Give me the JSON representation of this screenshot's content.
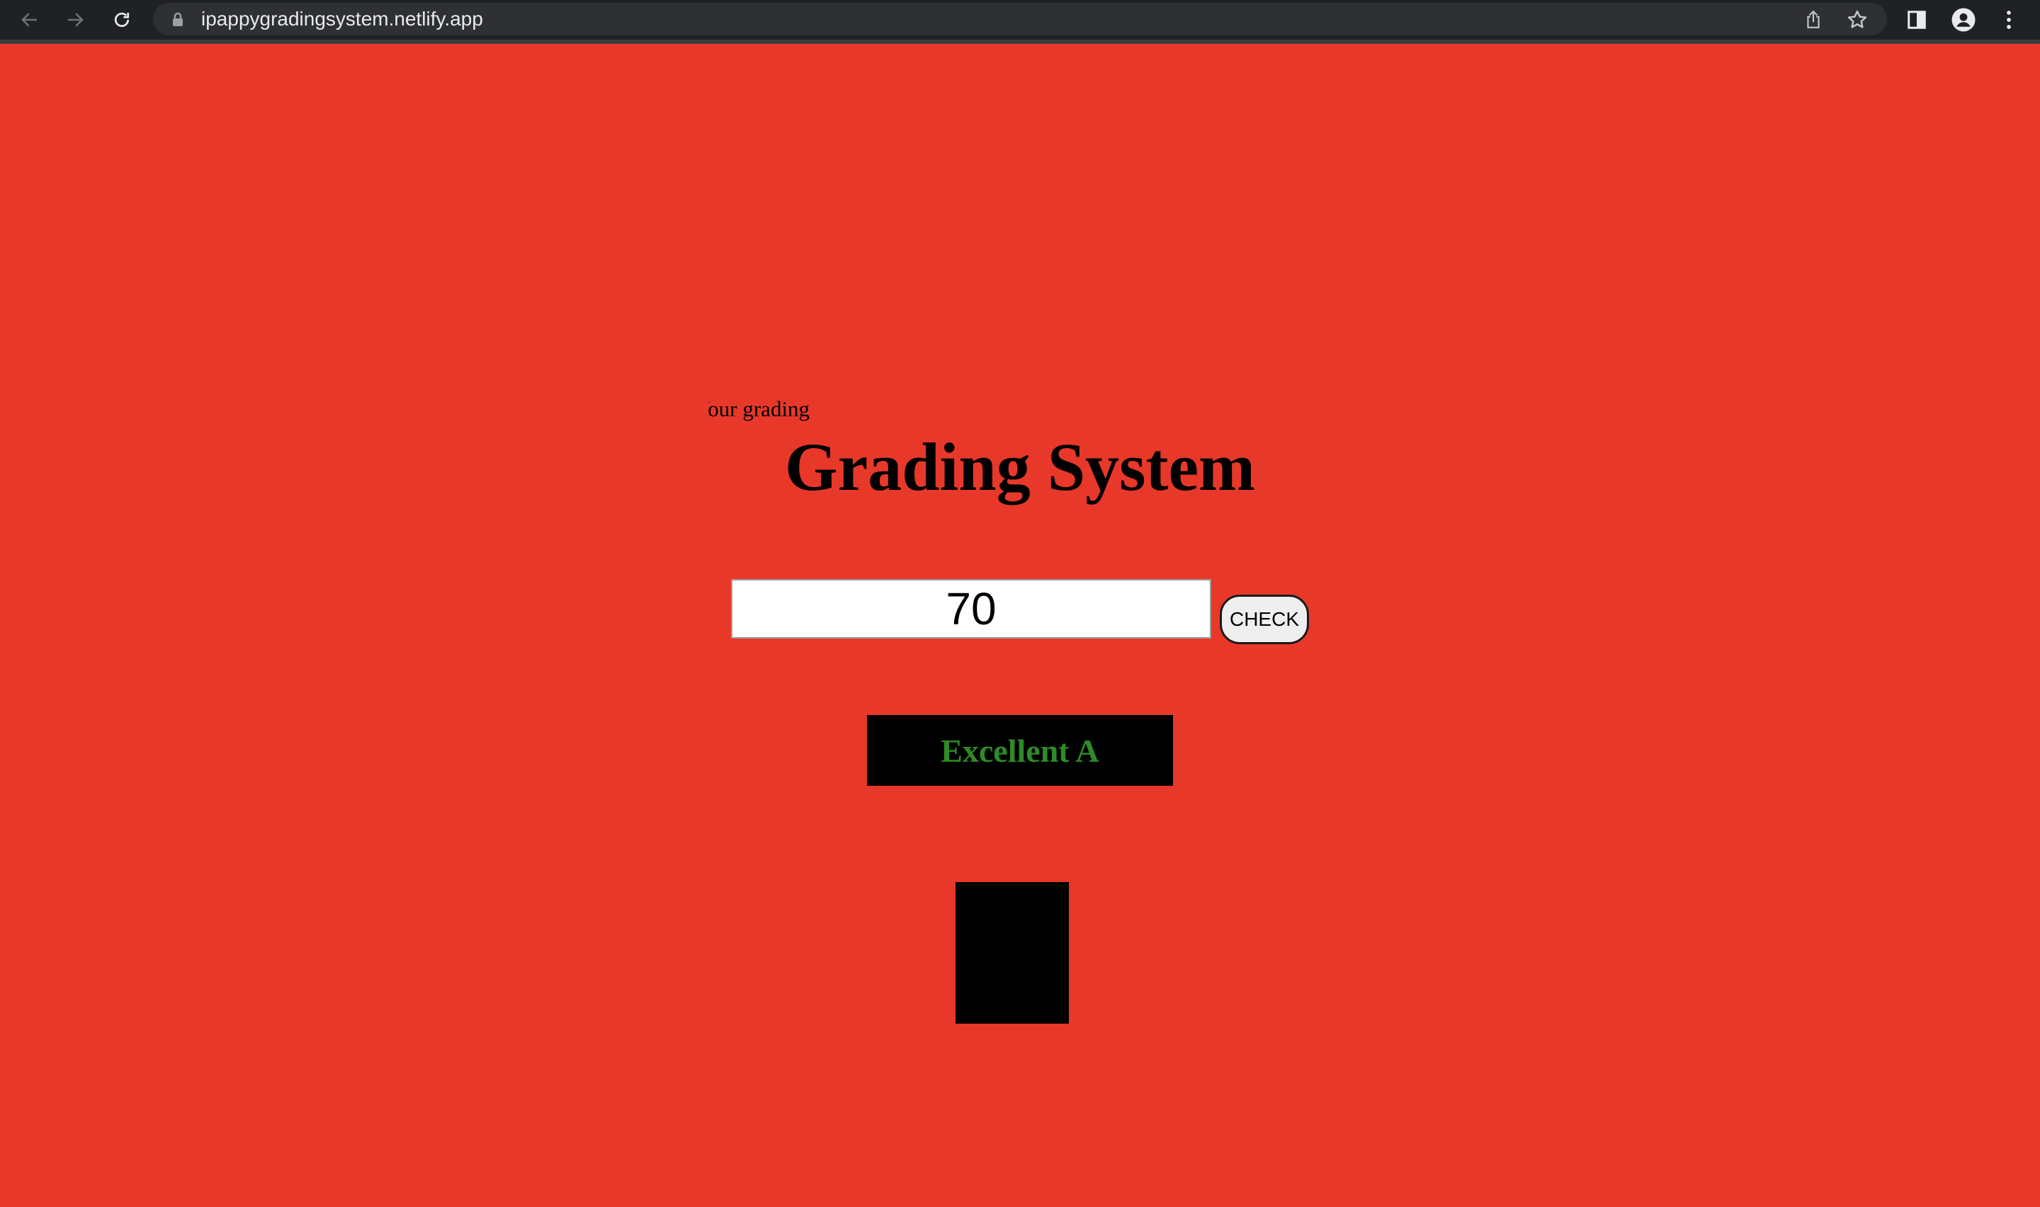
{
  "browser": {
    "url": "ipappygradingsystem.netlify.app",
    "icons": [
      "back-arrow-icon",
      "forward-arrow-icon",
      "reload-icon",
      "lock-icon",
      "share-icon",
      "star-icon",
      "side-panel-icon",
      "profile-icon",
      "more-menu-icon"
    ]
  },
  "page": {
    "marquee_text": "Your grading",
    "title": "Grading System",
    "score_value": "70",
    "check_label": "CHECK",
    "result_text": "Excellent A"
  },
  "colors": {
    "background": "#e8382a",
    "result_text": "#2e8b26",
    "result_box": "#000000"
  }
}
